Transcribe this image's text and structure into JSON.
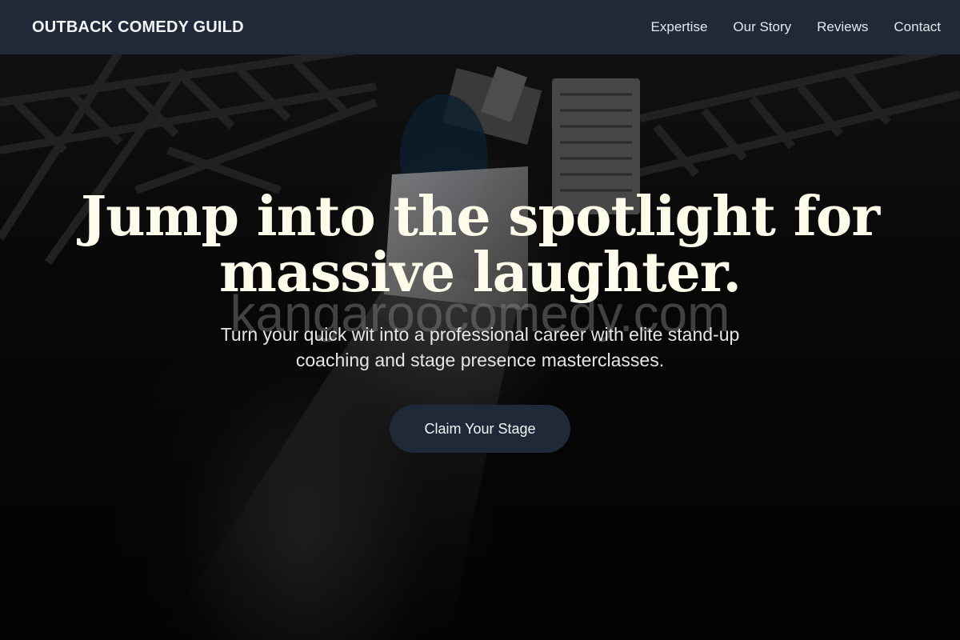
{
  "navbar": {
    "brand": "OUTBACK COMEDY GUILD",
    "links": [
      {
        "label": "Expertise"
      },
      {
        "label": "Our Story"
      },
      {
        "label": "Reviews"
      },
      {
        "label": "Contact"
      }
    ]
  },
  "hero": {
    "title": "Jump into the spotlight for massive laughter.",
    "subtitle": "Turn your quick wit into a professional career with elite stand-up coaching and stage presence masterclasses.",
    "cta_label": "Claim Your Stage",
    "watermark": "kangaroocomedy.com"
  },
  "colors": {
    "navbar_bg": "#1f2937",
    "title_color": "#fdfbe9",
    "cta_bg": "#1f2937",
    "hero_bg": "#000000"
  }
}
